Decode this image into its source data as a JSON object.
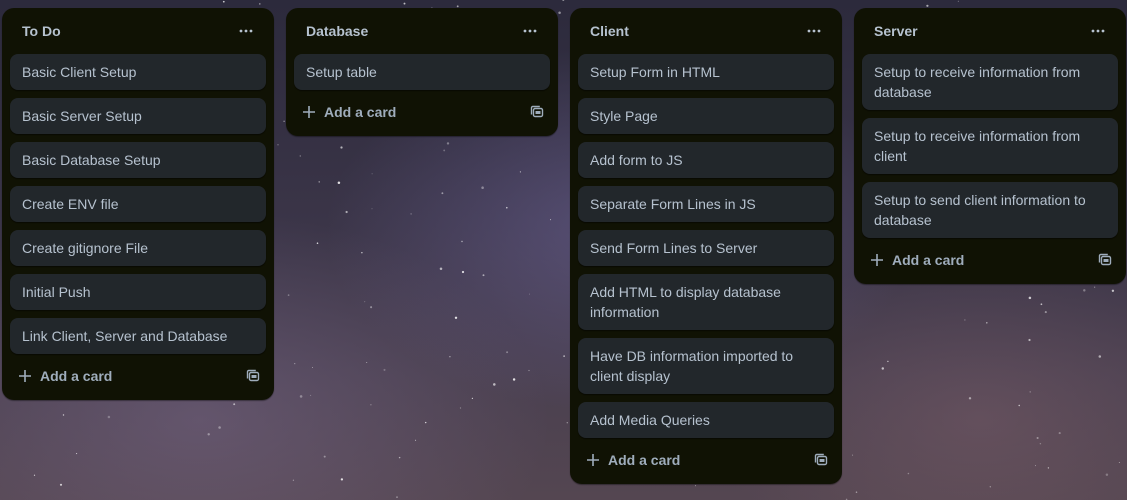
{
  "lists": [
    {
      "title": "To Do",
      "cards": [
        "Basic Client Setup",
        "Basic Server Setup",
        "Basic Database Setup",
        "Create ENV file",
        "Create gitignore File",
        "Initial Push",
        "Link Client, Server and Database"
      ],
      "add_label": "Add a card"
    },
    {
      "title": "Database",
      "cards": [
        "Setup table"
      ],
      "add_label": "Add a card"
    },
    {
      "title": "Client",
      "cards": [
        "Setup Form in HTML",
        "Style Page",
        "Add form to JS",
        "Separate Form Lines in JS",
        "Send Form Lines to Server",
        "Add HTML to display database information",
        "Have DB information imported to client display",
        "Add Media Queries"
      ],
      "add_label": "Add a card"
    },
    {
      "title": "Server",
      "cards": [
        "Setup to receive information from database",
        "Setup to receive information from client",
        "Setup to send client information to database"
      ],
      "add_label": "Add a card"
    }
  ],
  "icons": {
    "list_menu": "ellipsis-icon",
    "add": "plus-icon",
    "template": "card-template-icon"
  },
  "colors": {
    "list_background": "#101204",
    "card_background": "#22272b",
    "text": "#b6c2cf",
    "muted_text": "#9fadbc"
  }
}
